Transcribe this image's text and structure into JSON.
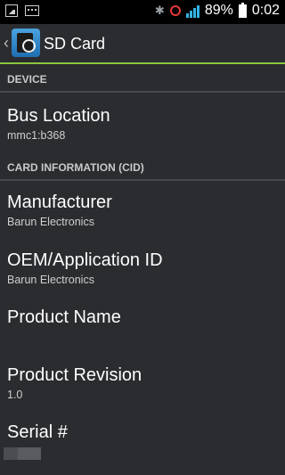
{
  "status_bar": {
    "left_icons": [
      "image-icon",
      "keyboard-icon"
    ],
    "right_icons": [
      "bluetooth-icon",
      "alarm-icon",
      "signal-icon",
      "battery-icon"
    ],
    "battery": "89%",
    "time": "0:02"
  },
  "action_bar": {
    "title": "SD Card",
    "accent_color": "#8cc63f"
  },
  "sections": {
    "device": "DEVICE",
    "card_info": "CARD INFORMATION (CID)"
  },
  "items": {
    "bus_location": {
      "title": "Bus Location",
      "summary": "mmc1:b368"
    },
    "manufacturer": {
      "title": "Manufacturer",
      "summary": "Barun Electronics"
    },
    "oem": {
      "title": "OEM/Application ID",
      "summary": "Barun Electronics"
    },
    "product_name": {
      "title": "Product Name",
      "summary": ""
    },
    "product_revision": {
      "title": "Product Revision",
      "summary": "1.0"
    },
    "serial": {
      "title": "Serial #",
      "summary": ""
    }
  }
}
